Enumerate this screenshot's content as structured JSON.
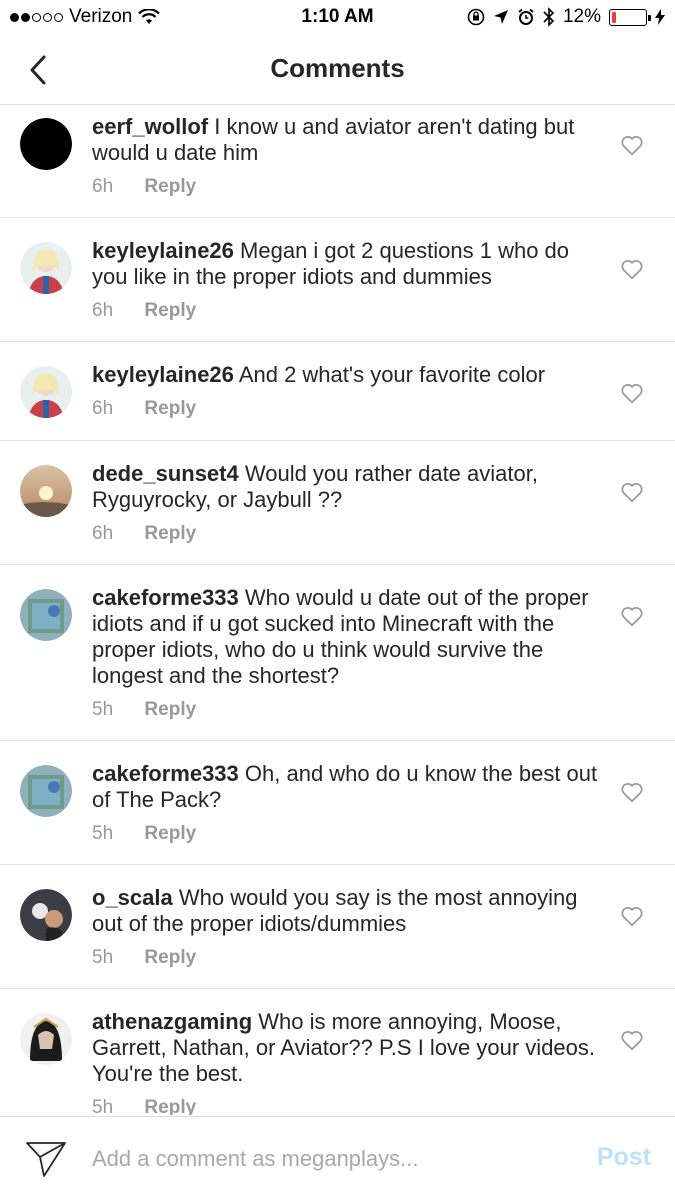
{
  "status_bar": {
    "carrier": "Verizon",
    "time": "1:10 AM",
    "battery_percent": "12%",
    "battery_level": 0.12,
    "signal_bars_filled": 2,
    "signal_bars_total": 5
  },
  "header": {
    "title": "Comments"
  },
  "comments": [
    {
      "username": "eerf_wollof",
      "text": "I know u and aviator aren't dating but would u date him",
      "time": "6h",
      "reply_label": "Reply"
    },
    {
      "username": "keyleylaine26",
      "text": "Megan i got 2 questions 1 who do you like in the proper idiots and dummies",
      "time": "6h",
      "reply_label": "Reply"
    },
    {
      "username": "keyleylaine26",
      "text": "And 2 what's your favorite color",
      "time": "6h",
      "reply_label": "Reply"
    },
    {
      "username": "dede_sunset4",
      "text": "Would you rather date aviator, Ryguyrocky, or Jaybull ??",
      "time": "6h",
      "reply_label": "Reply"
    },
    {
      "username": "cakeforme333",
      "text": "Who would u date out of the proper idiots and if u got sucked into Minecraft with the proper idiots, who do u think would survive the longest and the shortest?",
      "time": "5h",
      "reply_label": "Reply"
    },
    {
      "username": "cakeforme333",
      "text": "Oh, and who do u know the best out of The Pack?",
      "time": "5h",
      "reply_label": "Reply"
    },
    {
      "username": "o_scala",
      "text": "Who would you say is the most annoying out of the proper idiots/dummies",
      "time": "5h",
      "reply_label": "Reply"
    },
    {
      "username": "athenazgaming",
      "text": "Who is more annoying, Moose, Garrett, Nathan, or Aviator?? P.S I love your videos. You're the best.",
      "time": "5h",
      "reply_label": "Reply"
    }
  ],
  "composer": {
    "placeholder": "Add a comment as meganplays...",
    "post_label": "Post"
  },
  "colors": {
    "text": "#262626",
    "muted": "#999999",
    "post_disabled": "#bfe0fa",
    "battery_low": "#ff3b30",
    "divider": "#e6e6e6"
  },
  "icons": {
    "back": "chevron-left-icon",
    "like": "heart-outline-icon",
    "send": "paper-plane-icon",
    "wifi": "wifi-icon",
    "location": "location-arrow-icon",
    "alarm": "alarm-icon",
    "bluetooth": "bluetooth-icon",
    "orientation_lock": "orientation-lock-icon",
    "charging": "charging-bolt-icon"
  }
}
